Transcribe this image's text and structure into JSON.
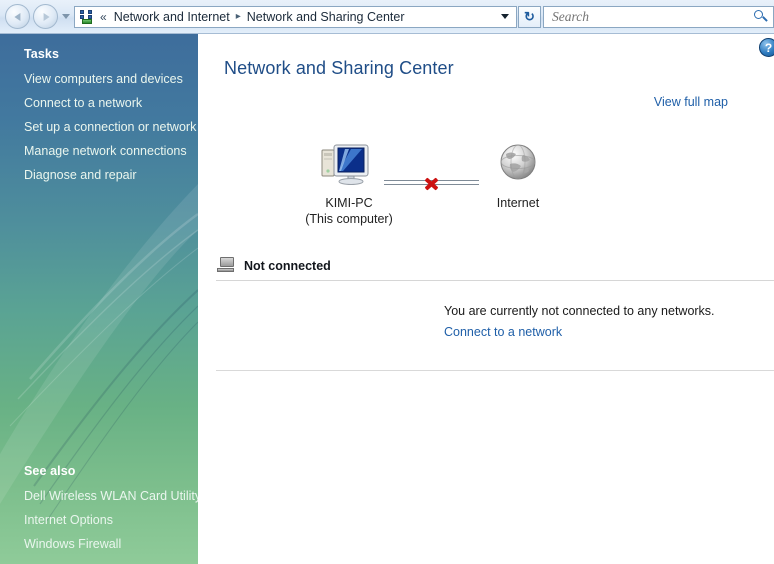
{
  "window": {
    "controls": [
      "minimize-button",
      "maximize-button",
      "close-button"
    ]
  },
  "navbar": {
    "back_icon": "back-arrow-icon",
    "forward_icon": "forward-arrow-icon",
    "recent_pages_icon": "chevron-down-icon",
    "address_icon": "network-icon",
    "overflow_chevrons": "«",
    "breadcrumbs": [
      {
        "label": "Network and Internet"
      },
      {
        "label": "Network and Sharing Center"
      }
    ],
    "breadcrumb_separator": "▸",
    "address_dropdown_icon": "chevron-down-icon",
    "refresh_glyph": "↻",
    "refresh_icon": "refresh-icon",
    "search": {
      "placeholder": "Search",
      "value": "",
      "icon": "search-icon"
    }
  },
  "sidebar": {
    "tasks_heading": "Tasks",
    "tasks": [
      {
        "label": "View computers and devices"
      },
      {
        "label": "Connect to a network"
      },
      {
        "label": "Set up a connection or network"
      },
      {
        "label": "Manage network connections"
      },
      {
        "label": "Diagnose and repair"
      }
    ],
    "see_also_heading": "See also",
    "see_also": [
      {
        "label": "Dell Wireless WLAN Card Utility"
      },
      {
        "label": "Internet Options"
      },
      {
        "label": "Windows Firewall"
      }
    ],
    "gradient_top": "#3e6d9c",
    "gradient_bottom": "#8fcb99"
  },
  "content": {
    "help_glyph": "?",
    "help_icon": "help-circle-icon",
    "page_title": "Network and Sharing Center",
    "title_color": "#1f4d87",
    "view_full_map_label": "View full map",
    "link_color": "#1f5fa8",
    "network_map": {
      "computer_node": {
        "icon": "computer-icon",
        "label": "KIMI-PC",
        "sublabel": "(This computer)"
      },
      "internet_node": {
        "icon": "globe-icon",
        "label": "Internet"
      },
      "connection": {
        "status_icon": "red-x-icon",
        "broken": true,
        "error_color": "#cc1111"
      }
    },
    "status_section": {
      "icon": "disconnected-computer-icon",
      "title": "Not connected",
      "message": "You are currently not connected to any networks.",
      "action_label": "Connect to a network"
    }
  }
}
